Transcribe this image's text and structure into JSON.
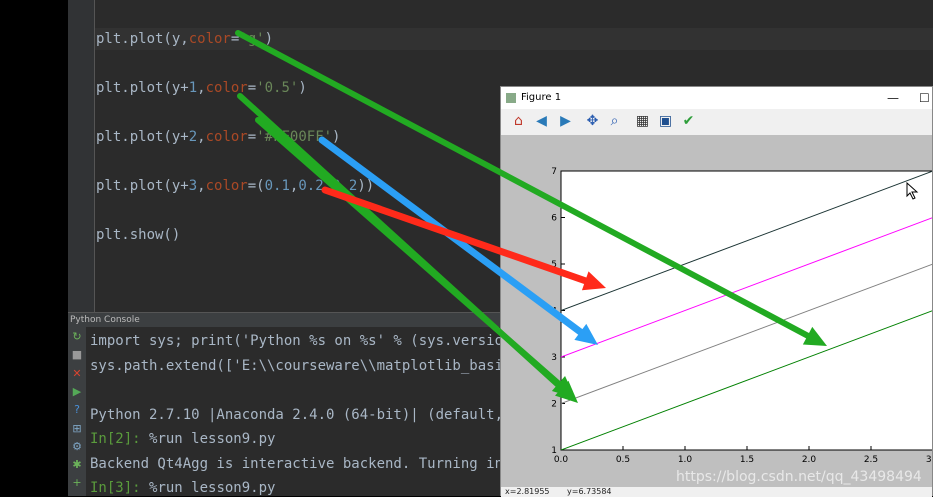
{
  "editor": {
    "lines": [
      {
        "segments": [
          {
            "t": "plt.plot(y,",
            "c": ""
          },
          {
            "t": "color",
            "c": "kw"
          },
          {
            "t": "=",
            "c": ""
          },
          {
            "t": "'g'",
            "c": "str"
          },
          {
            "t": ")",
            "c": ""
          }
        ]
      },
      {
        "segments": [
          {
            "t": "plt.plot(y+",
            "c": ""
          },
          {
            "t": "1",
            "c": "num"
          },
          {
            "t": ",",
            "c": ""
          },
          {
            "t": "color",
            "c": "kw"
          },
          {
            "t": "=",
            "c": ""
          },
          {
            "t": "'0.5'",
            "c": "str"
          },
          {
            "t": ")",
            "c": ""
          }
        ]
      },
      {
        "segments": [
          {
            "t": "plt.plot(y+",
            "c": ""
          },
          {
            "t": "2",
            "c": "num"
          },
          {
            "t": ",",
            "c": ""
          },
          {
            "t": "color",
            "c": "kw"
          },
          {
            "t": "=",
            "c": ""
          },
          {
            "t": "'#FF00FF'",
            "c": "str"
          },
          {
            "t": ")",
            "c": ""
          }
        ]
      },
      {
        "segments": [
          {
            "t": "plt.plot(y+",
            "c": ""
          },
          {
            "t": "3",
            "c": "num"
          },
          {
            "t": ",",
            "c": ""
          },
          {
            "t": "color",
            "c": "kw"
          },
          {
            "t": "=(",
            "c": ""
          },
          {
            "t": "0.1",
            "c": "num"
          },
          {
            "t": ",",
            "c": ""
          },
          {
            "t": "0.2",
            "c": "num"
          },
          {
            "t": ",",
            "c": ""
          },
          {
            "t": "0.2",
            "c": "num"
          },
          {
            "t": "))",
            "c": ""
          }
        ]
      },
      {
        "segments": [
          {
            "t": "plt.show()",
            "c": ""
          }
        ]
      }
    ]
  },
  "console": {
    "title": "Python Console",
    "lines": [
      {
        "segments": [
          {
            "t": "import sys; print('Python %s on %s' % (sys.version",
            "c": ""
          }
        ]
      },
      {
        "segments": [
          {
            "t": "sys.path.extend(['E:\\\\courseware\\\\matplotlib_basic",
            "c": ""
          }
        ]
      },
      {
        "segments": [
          {
            "t": "",
            "c": ""
          }
        ]
      },
      {
        "segments": [
          {
            "t": "Python 2.7.10 |Anaconda 2.4.0 (64-bit)| (default, ",
            "c": ""
          }
        ]
      },
      {
        "segments": [
          {
            "t": "In[2]: ",
            "c": "prompt"
          },
          {
            "t": "%run lesson9.py",
            "c": ""
          }
        ]
      },
      {
        "segments": [
          {
            "t": "Backend Qt4Agg is interactive backend. Turning int",
            "c": ""
          }
        ]
      },
      {
        "segments": [
          {
            "t": "In[3]: ",
            "c": "prompt"
          },
          {
            "t": "%run lesson9.py",
            "c": ""
          }
        ]
      }
    ],
    "tools": [
      {
        "icon": "rerun-icon",
        "glyph": "↻",
        "color": "#6cb35a"
      },
      {
        "icon": "stop-icon",
        "glyph": "■",
        "color": "#999999"
      },
      {
        "icon": "close-icon",
        "glyph": "✕",
        "color": "#d9442f"
      },
      {
        "icon": "run-icon",
        "glyph": "▶",
        "color": "#54a857"
      },
      {
        "icon": "help-icon",
        "glyph": "?",
        "color": "#4a8fd6"
      },
      {
        "icon": "variables-icon",
        "glyph": "⊞",
        "color": "#7fa7c7"
      },
      {
        "icon": "settings-icon",
        "glyph": "⚙",
        "color": "#7fa7c7"
      },
      {
        "icon": "debug-icon",
        "glyph": "✱",
        "color": "#6cb35a"
      },
      {
        "icon": "add-icon",
        "glyph": "+",
        "color": "#6cb35a"
      }
    ]
  },
  "figure": {
    "title": "Figure 1",
    "window_buttons": [
      "—",
      "☐"
    ],
    "toolbar": [
      {
        "icon": "home-icon",
        "glyph": "⌂",
        "color": "#c0392b"
      },
      {
        "icon": "back-icon",
        "glyph": "◀",
        "color": "#2a7ab8"
      },
      {
        "icon": "forward-icon",
        "glyph": "▶",
        "color": "#2a7ab8"
      },
      {
        "icon": "pan-icon",
        "glyph": "✥",
        "color": "#2a5db0"
      },
      {
        "icon": "zoom-icon",
        "glyph": "⌕",
        "color": "#2a5db0"
      },
      {
        "icon": "subplots-icon",
        "glyph": "▦",
        "color": "#333333"
      },
      {
        "icon": "save-icon",
        "glyph": "▣",
        "color": "#1f4f8f"
      },
      {
        "icon": "edit-icon",
        "glyph": "✔",
        "color": "#2e9e3a"
      }
    ],
    "coords_x": "x=2.81955",
    "coords_y": "y=6.73584"
  },
  "chart_data": {
    "type": "line",
    "title": "",
    "xlabel": "",
    "ylabel": "",
    "xlim": [
      0,
      3
    ],
    "ylim": [
      1,
      7
    ],
    "xticks": [
      "0.0",
      "0.5",
      "1.0",
      "1.5",
      "2.0",
      "2.5",
      "3.0"
    ],
    "yticks": [
      "1",
      "2",
      "3",
      "4",
      "5",
      "6",
      "7"
    ],
    "grid": false,
    "series": [
      {
        "color": "#008000",
        "x": [
          0,
          3
        ],
        "y": [
          1,
          4
        ]
      },
      {
        "color": "#808080",
        "x": [
          0,
          3
        ],
        "y": [
          2,
          5
        ]
      },
      {
        "color": "#FF00FF",
        "x": [
          0,
          3
        ],
        "y": [
          3,
          6
        ]
      },
      {
        "color": "#1a3333",
        "x": [
          0,
          3
        ],
        "y": [
          4,
          7
        ]
      }
    ]
  },
  "annotations": {
    "arrows": [
      {
        "color": "#22aa22"
      },
      {
        "color": "#22aa22"
      },
      {
        "color": "#22aa22"
      },
      {
        "color": "#2b9ff5"
      },
      {
        "color": "#ff2a1a"
      }
    ]
  },
  "watermark": "https://blog.csdn.net/qq_43498494"
}
